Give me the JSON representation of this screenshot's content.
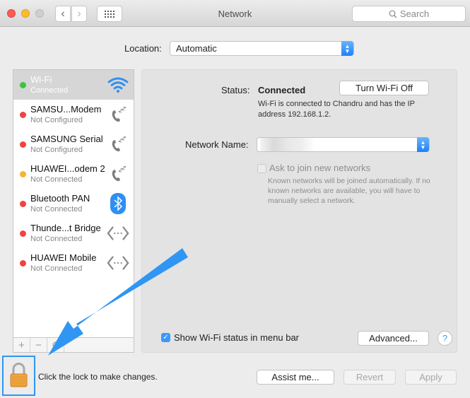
{
  "window": {
    "title": "Network",
    "search_placeholder": "Search"
  },
  "location": {
    "label": "Location:",
    "value": "Automatic"
  },
  "services": [
    {
      "name": "Wi-Fi",
      "status": "Connected",
      "dot_color": "#3cc43c",
      "icon": "wifi-icon",
      "selected": true
    },
    {
      "name": "SAMSU...Modem",
      "status": "Not Configured",
      "dot_color": "#f0443e",
      "icon": "phone-modem-icon"
    },
    {
      "name": "SAMSUNG Serial",
      "status": "Not Configured",
      "dot_color": "#f0443e",
      "icon": "phone-modem-icon"
    },
    {
      "name": "HUAWEI...odem 2",
      "status": "Not Connected",
      "dot_color": "#f6b52e",
      "icon": "phone-modem-icon"
    },
    {
      "name": "Bluetooth PAN",
      "status": "Not Connected",
      "dot_color": "#f0443e",
      "icon": "bluetooth-icon"
    },
    {
      "name": "Thunde...t Bridge",
      "status": "Not Connected",
      "dot_color": "#f0443e",
      "icon": "ethernet-icon"
    },
    {
      "name": "HUAWEI Mobile",
      "status": "Not Connected",
      "dot_color": "#f0443e",
      "icon": "ethernet-icon"
    }
  ],
  "sidebar_footer": {
    "add": "+",
    "remove": "−"
  },
  "detail": {
    "status_label": "Status:",
    "status_value": "Connected",
    "turn_off_button": "Turn Wi-Fi Off",
    "status_description": "Wi-Fi is connected to Chandru and has the IP address 192.168.1.2.",
    "network_name_label": "Network Name:",
    "network_name_value": "",
    "ask_join_label": "Ask to join new networks",
    "ask_join_checked": false,
    "ask_join_description": "Known networks will be joined automatically. If no known networks are available, you will have to manually select a network.",
    "show_status_label": "Show Wi-Fi status in menu bar",
    "show_status_checked": true,
    "advanced_button": "Advanced...",
    "help_button": "?"
  },
  "footer": {
    "lock_text": "Click the lock to make changes.",
    "assist_button": "Assist me...",
    "revert_button": "Revert",
    "apply_button": "Apply"
  },
  "colors": {
    "accent": "#3b99fc",
    "annotation_arrow": "#2f96f4"
  }
}
